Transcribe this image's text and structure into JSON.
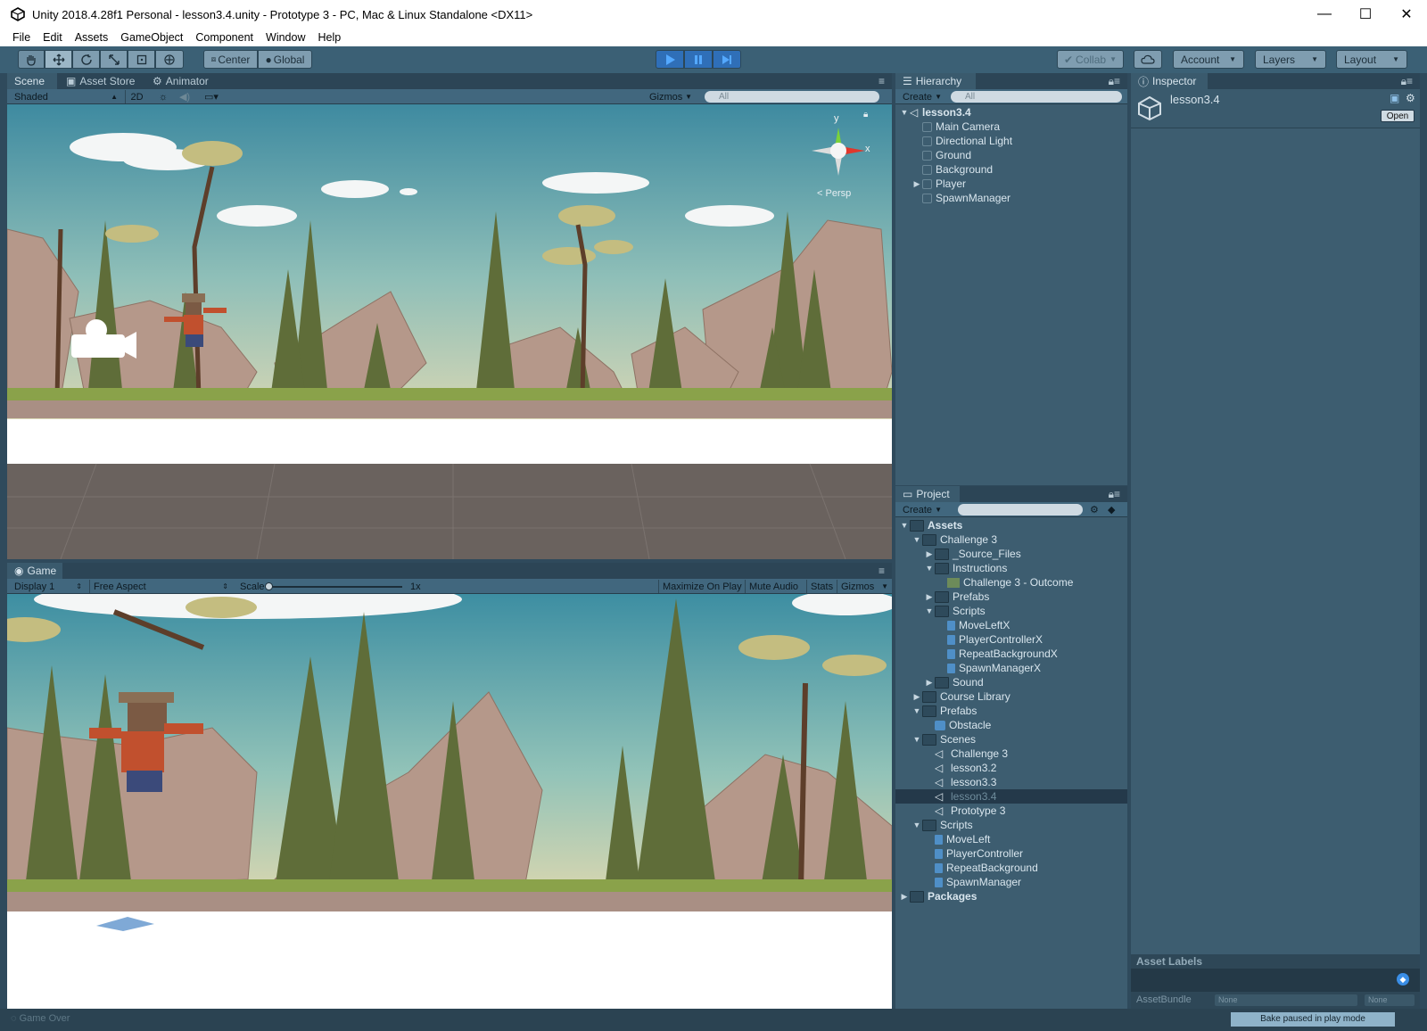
{
  "window": {
    "title": "Unity 2018.4.28f1 Personal - lesson3.4.unity - Prototype 3 - PC, Mac & Linux Standalone <DX11>",
    "controls": [
      "—",
      "☐",
      "✕"
    ]
  },
  "menu": [
    "File",
    "Edit",
    "Assets",
    "GameObject",
    "Component",
    "Window",
    "Help"
  ],
  "toolbar": {
    "center_label": "Center",
    "global_label": "Global",
    "collab_label": "Collab",
    "account_label": "Account",
    "layers_label": "Layers",
    "layout_label": "Layout"
  },
  "scene_panel": {
    "tabs": [
      "Scene",
      "Asset Store",
      "Animator"
    ],
    "shading_mode": "Shaded",
    "mode_2d": "2D",
    "gizmos_label": "Gizmos",
    "search_placeholder": "All",
    "persp_label": "Persp",
    "gizmo_axis_y": "y",
    "gizmo_axis_x": "x"
  },
  "game_panel": {
    "tab": "Game",
    "display": "Display 1",
    "aspect": "Free Aspect",
    "scale_label": "Scale",
    "scale_value": "1x",
    "buttons": [
      "Maximize On Play",
      "Mute Audio",
      "Stats",
      "Gizmos"
    ]
  },
  "hierarchy": {
    "tab": "Hierarchy",
    "create_label": "Create",
    "search_placeholder": "All",
    "scene_name": "lesson3.4",
    "items": [
      "Main Camera",
      "Directional Light",
      "Ground",
      "Background",
      "Player",
      "SpawnManager"
    ]
  },
  "project": {
    "tab": "Project",
    "create_label": "Create",
    "tree": [
      {
        "label": "Assets",
        "depth": 0,
        "type": "folder",
        "expanded": true,
        "bold": true
      },
      {
        "label": "Challenge 3",
        "depth": 1,
        "type": "folder",
        "expanded": true
      },
      {
        "label": "_Source_Files",
        "depth": 2,
        "type": "folder",
        "collapsed": true
      },
      {
        "label": "Instructions",
        "depth": 2,
        "type": "folder",
        "expanded": true
      },
      {
        "label": "Challenge 3 - Outcome",
        "depth": 3,
        "type": "media"
      },
      {
        "label": "Prefabs",
        "depth": 2,
        "type": "folder",
        "collapsed": true
      },
      {
        "label": "Scripts",
        "depth": 2,
        "type": "folder",
        "expanded": true
      },
      {
        "label": "MoveLeftX",
        "depth": 3,
        "type": "script"
      },
      {
        "label": "PlayerControllerX",
        "depth": 3,
        "type": "script"
      },
      {
        "label": "RepeatBackgroundX",
        "depth": 3,
        "type": "script"
      },
      {
        "label": "SpawnManagerX",
        "depth": 3,
        "type": "script"
      },
      {
        "label": "Sound",
        "depth": 2,
        "type": "folder",
        "collapsed": true
      },
      {
        "label": "Course Library",
        "depth": 1,
        "type": "folder",
        "collapsed": true
      },
      {
        "label": "Prefabs",
        "depth": 1,
        "type": "folder",
        "expanded": true
      },
      {
        "label": "Obstacle",
        "depth": 2,
        "type": "prefab"
      },
      {
        "label": "Scenes",
        "depth": 1,
        "type": "folder",
        "expanded": true
      },
      {
        "label": "Challenge 3",
        "depth": 2,
        "type": "scene"
      },
      {
        "label": "lesson3.2",
        "depth": 2,
        "type": "scene"
      },
      {
        "label": "lesson3.3",
        "depth": 2,
        "type": "scene"
      },
      {
        "label": "lesson3.4",
        "depth": 2,
        "type": "scene",
        "selected": true
      },
      {
        "label": "Prototype 3",
        "depth": 2,
        "type": "scene"
      },
      {
        "label": "Scripts",
        "depth": 1,
        "type": "folder",
        "expanded": true
      },
      {
        "label": "MoveLeft",
        "depth": 2,
        "type": "script"
      },
      {
        "label": "PlayerController",
        "depth": 2,
        "type": "script"
      },
      {
        "label": "RepeatBackground",
        "depth": 2,
        "type": "script"
      },
      {
        "label": "SpawnManager",
        "depth": 2,
        "type": "script"
      },
      {
        "label": "Packages",
        "depth": 0,
        "type": "folder",
        "collapsed": true,
        "bold": true
      }
    ]
  },
  "inspector": {
    "tab": "Inspector",
    "asset_name": "lesson3.4",
    "open_label": "Open",
    "asset_labels": "Asset Labels",
    "asset_bundle_label": "AssetBundle",
    "bundle_value_1": "None",
    "bundle_value_2": "None"
  },
  "status": {
    "message": "Game Over",
    "bake": "Bake paused in play mode"
  },
  "colors": {
    "editor_bg": "#3d5d70",
    "toolbar_bg": "#3b6075",
    "play_active": "#3a8ee6"
  }
}
